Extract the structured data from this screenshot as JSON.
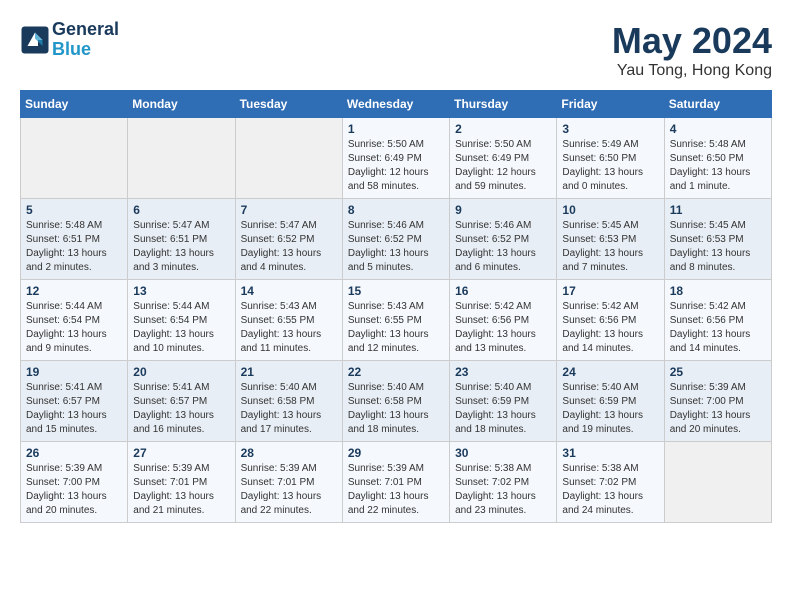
{
  "header": {
    "logo_line1": "General",
    "logo_line2": "Blue",
    "month_title": "May 2024",
    "location": "Yau Tong, Hong Kong"
  },
  "days_of_week": [
    "Sunday",
    "Monday",
    "Tuesday",
    "Wednesday",
    "Thursday",
    "Friday",
    "Saturday"
  ],
  "weeks": [
    [
      {
        "day": "",
        "info": ""
      },
      {
        "day": "",
        "info": ""
      },
      {
        "day": "",
        "info": ""
      },
      {
        "day": "1",
        "info": "Sunrise: 5:50 AM\nSunset: 6:49 PM\nDaylight: 12 hours\nand 58 minutes."
      },
      {
        "day": "2",
        "info": "Sunrise: 5:50 AM\nSunset: 6:49 PM\nDaylight: 12 hours\nand 59 minutes."
      },
      {
        "day": "3",
        "info": "Sunrise: 5:49 AM\nSunset: 6:50 PM\nDaylight: 13 hours\nand 0 minutes."
      },
      {
        "day": "4",
        "info": "Sunrise: 5:48 AM\nSunset: 6:50 PM\nDaylight: 13 hours\nand 1 minute."
      }
    ],
    [
      {
        "day": "5",
        "info": "Sunrise: 5:48 AM\nSunset: 6:51 PM\nDaylight: 13 hours\nand 2 minutes."
      },
      {
        "day": "6",
        "info": "Sunrise: 5:47 AM\nSunset: 6:51 PM\nDaylight: 13 hours\nand 3 minutes."
      },
      {
        "day": "7",
        "info": "Sunrise: 5:47 AM\nSunset: 6:52 PM\nDaylight: 13 hours\nand 4 minutes."
      },
      {
        "day": "8",
        "info": "Sunrise: 5:46 AM\nSunset: 6:52 PM\nDaylight: 13 hours\nand 5 minutes."
      },
      {
        "day": "9",
        "info": "Sunrise: 5:46 AM\nSunset: 6:52 PM\nDaylight: 13 hours\nand 6 minutes."
      },
      {
        "day": "10",
        "info": "Sunrise: 5:45 AM\nSunset: 6:53 PM\nDaylight: 13 hours\nand 7 minutes."
      },
      {
        "day": "11",
        "info": "Sunrise: 5:45 AM\nSunset: 6:53 PM\nDaylight: 13 hours\nand 8 minutes."
      }
    ],
    [
      {
        "day": "12",
        "info": "Sunrise: 5:44 AM\nSunset: 6:54 PM\nDaylight: 13 hours\nand 9 minutes."
      },
      {
        "day": "13",
        "info": "Sunrise: 5:44 AM\nSunset: 6:54 PM\nDaylight: 13 hours\nand 10 minutes."
      },
      {
        "day": "14",
        "info": "Sunrise: 5:43 AM\nSunset: 6:55 PM\nDaylight: 13 hours\nand 11 minutes."
      },
      {
        "day": "15",
        "info": "Sunrise: 5:43 AM\nSunset: 6:55 PM\nDaylight: 13 hours\nand 12 minutes."
      },
      {
        "day": "16",
        "info": "Sunrise: 5:42 AM\nSunset: 6:56 PM\nDaylight: 13 hours\nand 13 minutes."
      },
      {
        "day": "17",
        "info": "Sunrise: 5:42 AM\nSunset: 6:56 PM\nDaylight: 13 hours\nand 14 minutes."
      },
      {
        "day": "18",
        "info": "Sunrise: 5:42 AM\nSunset: 6:56 PM\nDaylight: 13 hours\nand 14 minutes."
      }
    ],
    [
      {
        "day": "19",
        "info": "Sunrise: 5:41 AM\nSunset: 6:57 PM\nDaylight: 13 hours\nand 15 minutes."
      },
      {
        "day": "20",
        "info": "Sunrise: 5:41 AM\nSunset: 6:57 PM\nDaylight: 13 hours\nand 16 minutes."
      },
      {
        "day": "21",
        "info": "Sunrise: 5:40 AM\nSunset: 6:58 PM\nDaylight: 13 hours\nand 17 minutes."
      },
      {
        "day": "22",
        "info": "Sunrise: 5:40 AM\nSunset: 6:58 PM\nDaylight: 13 hours\nand 18 minutes."
      },
      {
        "day": "23",
        "info": "Sunrise: 5:40 AM\nSunset: 6:59 PM\nDaylight: 13 hours\nand 18 minutes."
      },
      {
        "day": "24",
        "info": "Sunrise: 5:40 AM\nSunset: 6:59 PM\nDaylight: 13 hours\nand 19 minutes."
      },
      {
        "day": "25",
        "info": "Sunrise: 5:39 AM\nSunset: 7:00 PM\nDaylight: 13 hours\nand 20 minutes."
      }
    ],
    [
      {
        "day": "26",
        "info": "Sunrise: 5:39 AM\nSunset: 7:00 PM\nDaylight: 13 hours\nand 20 minutes."
      },
      {
        "day": "27",
        "info": "Sunrise: 5:39 AM\nSunset: 7:01 PM\nDaylight: 13 hours\nand 21 minutes."
      },
      {
        "day": "28",
        "info": "Sunrise: 5:39 AM\nSunset: 7:01 PM\nDaylight: 13 hours\nand 22 minutes."
      },
      {
        "day": "29",
        "info": "Sunrise: 5:39 AM\nSunset: 7:01 PM\nDaylight: 13 hours\nand 22 minutes."
      },
      {
        "day": "30",
        "info": "Sunrise: 5:38 AM\nSunset: 7:02 PM\nDaylight: 13 hours\nand 23 minutes."
      },
      {
        "day": "31",
        "info": "Sunrise: 5:38 AM\nSunset: 7:02 PM\nDaylight: 13 hours\nand 24 minutes."
      },
      {
        "day": "",
        "info": ""
      }
    ]
  ]
}
